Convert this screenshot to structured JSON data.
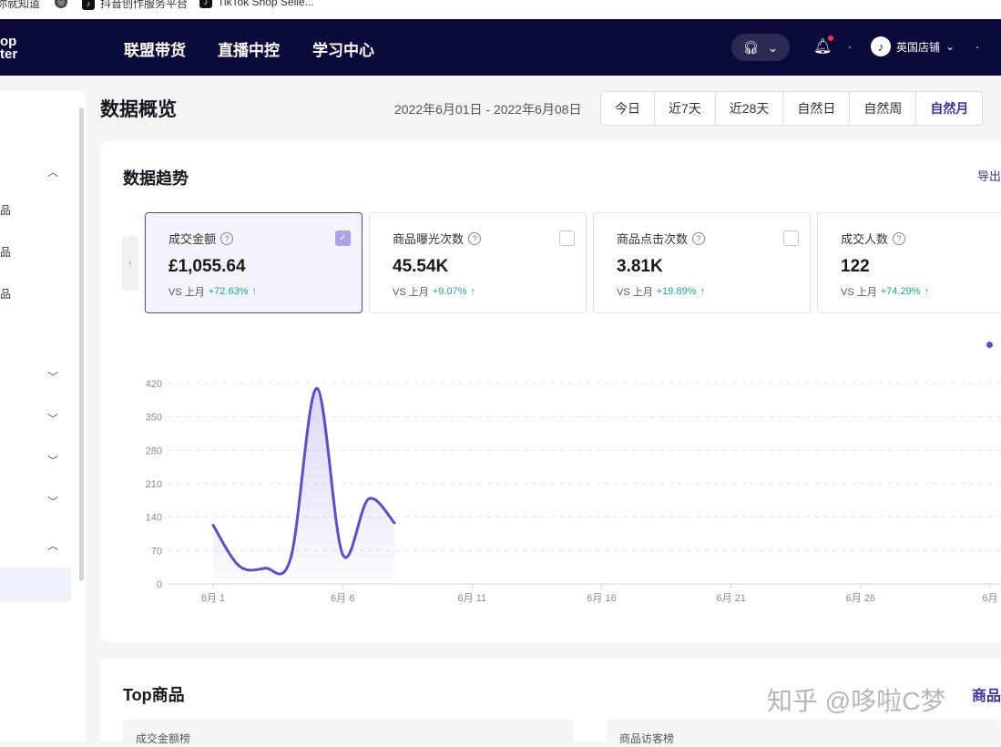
{
  "bookmarks": [
    {
      "label": "你就知道",
      "icon": "bookmark-icon"
    },
    {
      "label": "",
      "icon": "globe-icon"
    },
    {
      "label": "抖音创作服务平台",
      "icon": "tiktok-icon"
    },
    {
      "label": "TikTok Shop Selle...",
      "icon": "tiktok-icon"
    }
  ],
  "topnav": {
    "logo_line1": "op",
    "logo_line2": "ter",
    "items": [
      "联盟带货",
      "直播中控",
      "学习中心"
    ],
    "shop_name": "英国店铺"
  },
  "sidebar": {
    "labels": [
      "品",
      "品",
      "品"
    ]
  },
  "page": {
    "title": "数据概览",
    "date_range": "2022年6月01日 - 2022年6月08日",
    "range_tabs": [
      "今日",
      "近7天",
      "近28天",
      "自然日",
      "自然周",
      "自然月"
    ]
  },
  "trend": {
    "title": "数据趋势",
    "export_label": "导出",
    "metrics": [
      {
        "name": "成交金额",
        "value": "£1,055.64",
        "cmp_label": "VS 上月",
        "delta": "+72.63%",
        "checked": true
      },
      {
        "name": "商品曝光次数",
        "value": "45.54K",
        "cmp_label": "VS 上月",
        "delta": "+9.07%",
        "checked": false
      },
      {
        "name": "商品点击次数",
        "value": "3.81K",
        "cmp_label": "VS 上月",
        "delta": "+19.89%",
        "checked": false
      },
      {
        "name": "成交人数",
        "value": "122",
        "cmp_label": "VS 上月",
        "delta": "+74.29%",
        "checked": false
      }
    ]
  },
  "chart_data": {
    "type": "area",
    "x_ticks": [
      "6月 1",
      "6月 6",
      "6月 11",
      "6月 16",
      "6月 21",
      "6月 26",
      "6月"
    ],
    "y_ticks": [
      0,
      70,
      140,
      210,
      280,
      350,
      420
    ],
    "ylim": [
      0,
      420
    ],
    "grid": true,
    "color": "#5a4fc7",
    "series": [
      {
        "x": [
          "6月1",
          "6月2",
          "6月3",
          "6月4",
          "6月5",
          "6月6",
          "6月7",
          "6月8"
        ],
        "values": [
          123,
          38,
          33,
          55,
          410,
          62,
          178,
          128
        ]
      }
    ]
  },
  "top_products": {
    "title": "Top商品",
    "link_label": "商品",
    "watermark": "知乎 @哆啦C梦",
    "sub_left": "成交金额榜",
    "sub_right": "商品访客榜"
  }
}
